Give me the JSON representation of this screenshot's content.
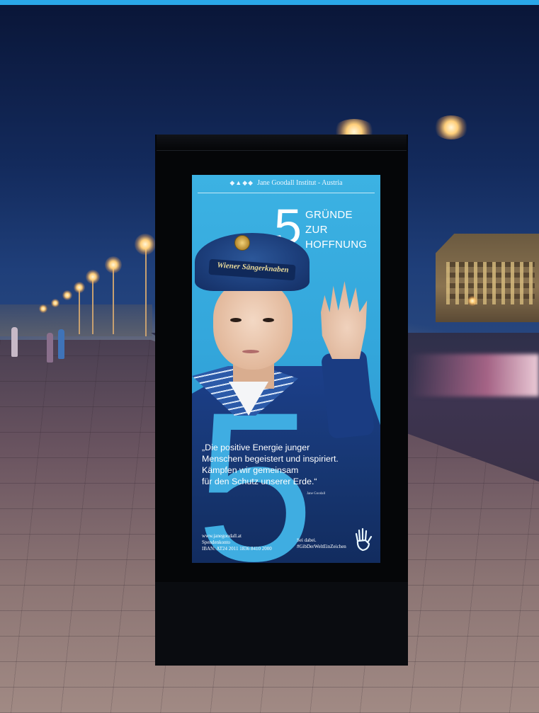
{
  "poster": {
    "organization": "Jane Goodall Institut - Austria",
    "headline_number": "5",
    "headline_lines": [
      "GRÜNDE",
      "ZUR",
      "HOFFNUNG"
    ],
    "cap_text": "Wiener Sängerknaben",
    "quote_lines": [
      "„Die positive Energie junger",
      "Menschen begeistert und inspiriert.",
      "Kämpfen wir gemeinsam",
      "für den Schutz unserer Erde.“"
    ],
    "quote_author": "Jane Goodall",
    "footer_left": [
      "www.janegoodall.at",
      "Spendenkonto",
      "IBAN: AT24 2011 1836 8410 2000"
    ],
    "footer_right": [
      "Sei dabei.",
      "#GibDerWeltEinZeichen"
    ],
    "accent_color": "#3cb2e3",
    "icon": "hand-icon"
  }
}
